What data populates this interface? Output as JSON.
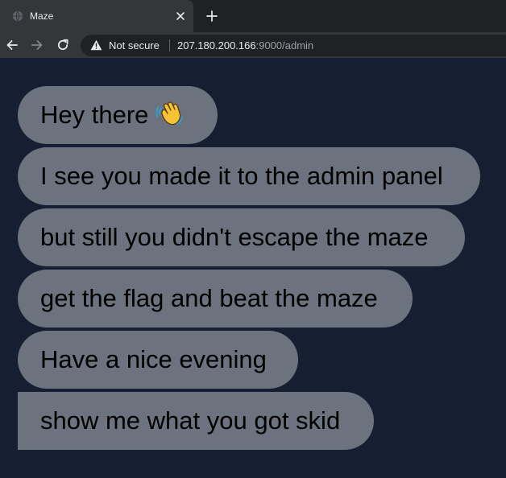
{
  "browser": {
    "tab": {
      "title": "Maze",
      "favicon": "globe-icon",
      "close_icon": "close-icon"
    },
    "new_tab_icon": "plus-icon",
    "nav": {
      "back_icon": "arrow-left-icon",
      "forward_icon": "arrow-right-icon",
      "reload_icon": "reload-icon"
    },
    "omnibox": {
      "security_icon": "warning-icon",
      "security_label": "Not secure",
      "url_host": "207.180.200.166",
      "url_rest": ":9000/admin"
    }
  },
  "messages": [
    {
      "text": "Hey there",
      "emoji": "waving-hand-icon"
    },
    {
      "text": "I see you made it to the admin panel"
    },
    {
      "text": "but still you didn't escape the maze"
    },
    {
      "text": "get the flag and beat the maze"
    },
    {
      "text": "Have a nice evening"
    },
    {
      "text": "show me what you got skid"
    }
  ],
  "colors": {
    "page_background": "#161e31",
    "bubble": "#6c727e",
    "bubble_text": "#000000",
    "tabstrip": "#202124",
    "toolbar": "#35363a"
  }
}
